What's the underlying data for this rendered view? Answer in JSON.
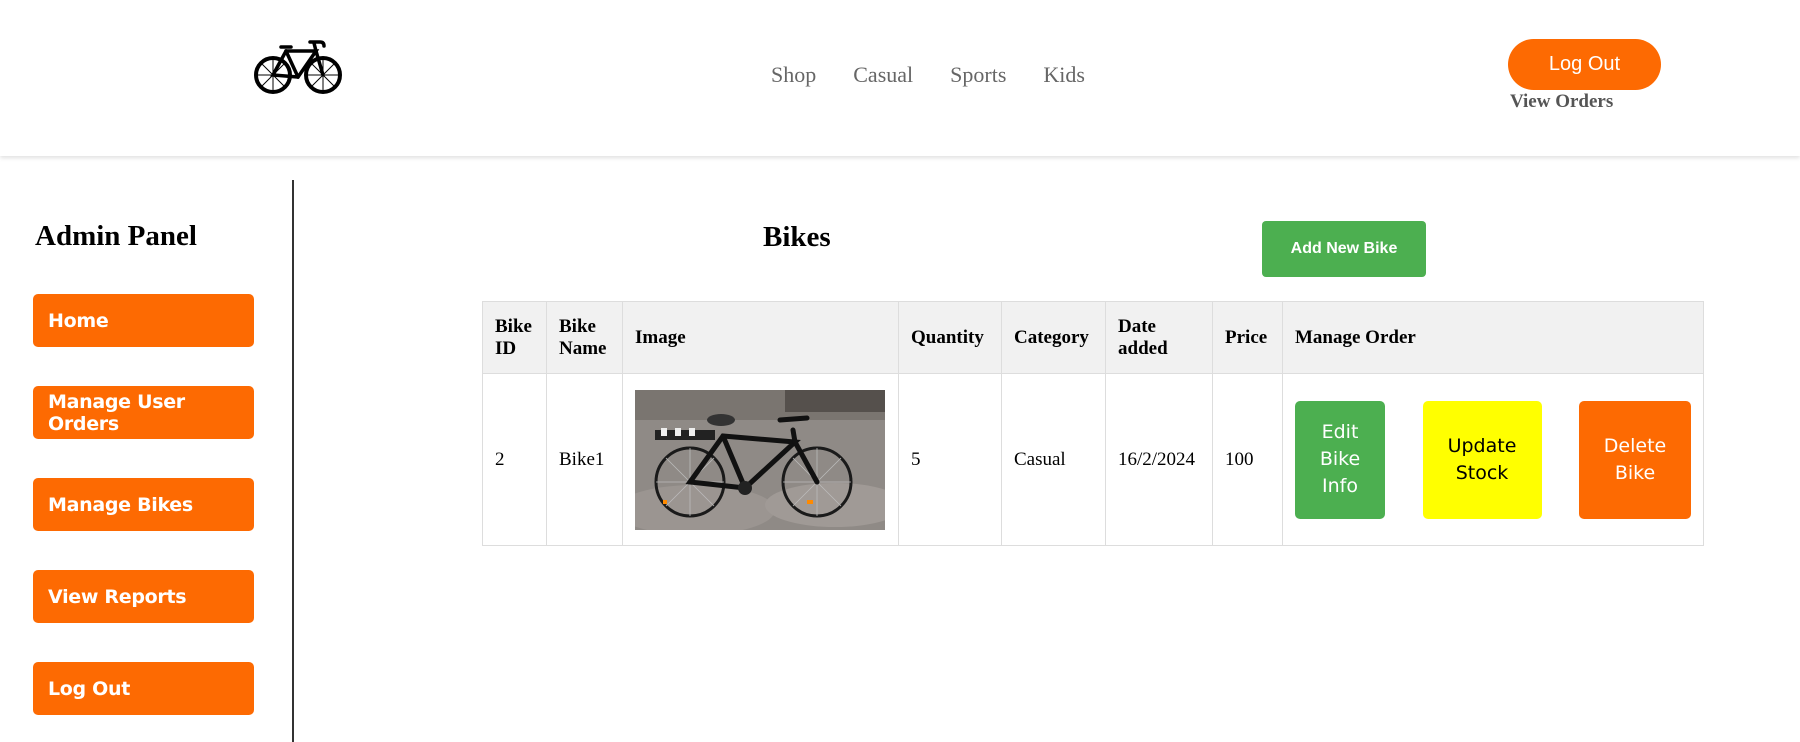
{
  "header": {
    "logo_icon": "bicycle-icon",
    "nav": [
      "Shop",
      "Casual",
      "Sports",
      "Kids"
    ],
    "logout_label": "Log Out",
    "view_orders_label": "View Orders"
  },
  "sidebar": {
    "title": "Admin Panel",
    "items": [
      "Home",
      "Manage User Orders",
      "Manage Bikes",
      "View Reports",
      "Log Out"
    ]
  },
  "main": {
    "title": "Bikes",
    "add_button": "Add New Bike",
    "columns": [
      "Bike ID",
      "Bike Name",
      "Image",
      "Quantity",
      "Category",
      "Date added",
      "Price",
      "Manage Order"
    ],
    "rows": [
      {
        "id": "2",
        "name": "Bike1",
        "image_icon": "bike-photo",
        "quantity": "5",
        "category": "Casual",
        "date_added": "16/2/2024",
        "price": "100",
        "actions": {
          "edit": "Edit Bike Info",
          "update": "Update Stock",
          "delete": "Delete Bike"
        }
      }
    ]
  },
  "colors": {
    "accent_orange": "#fd6a02",
    "green": "#4caf50",
    "yellow": "#ffff00"
  }
}
